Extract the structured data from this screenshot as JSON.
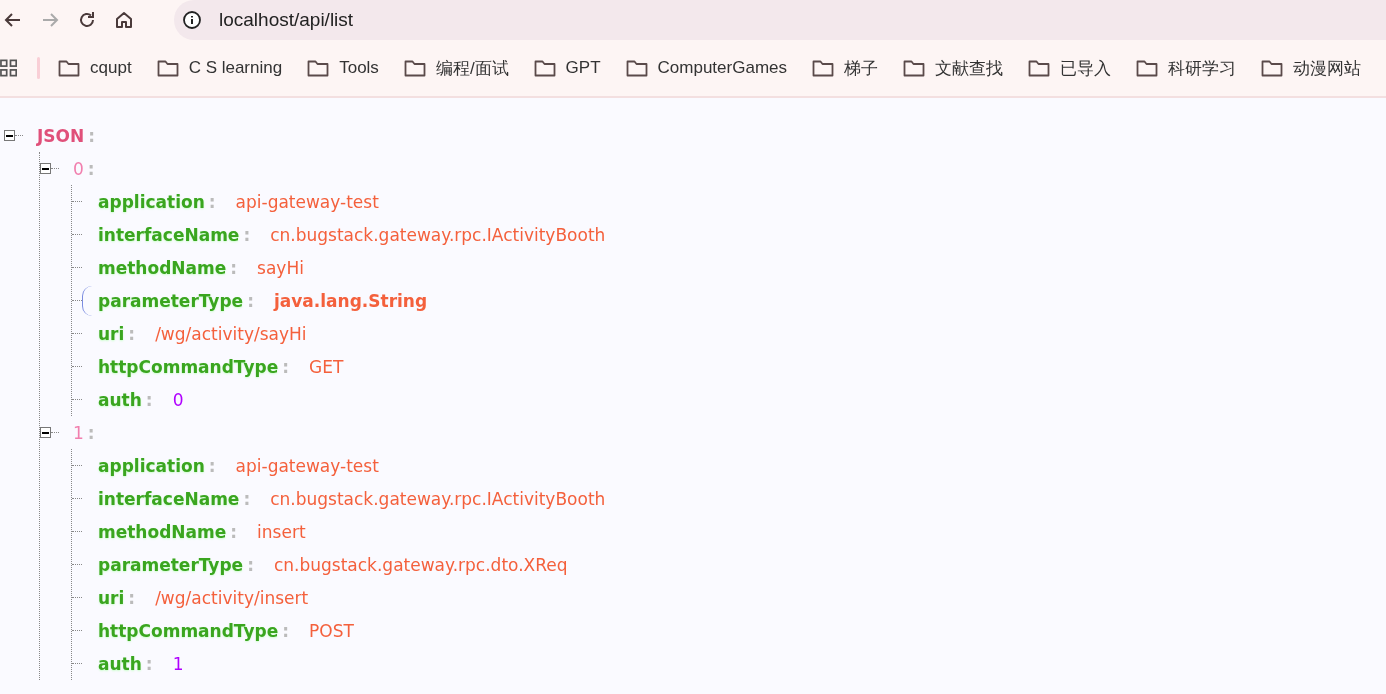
{
  "toolbar": {
    "back": {
      "disabled": false
    },
    "forward": {
      "disabled": true
    },
    "url": "localhost/api/list"
  },
  "bookmarks": [
    {
      "label": "cqupt"
    },
    {
      "label": "C S learning"
    },
    {
      "label": "Tools"
    },
    {
      "label": "编程/面试"
    },
    {
      "label": "GPT"
    },
    {
      "label": "ComputerGames"
    },
    {
      "label": "梯子"
    },
    {
      "label": "文献查找"
    },
    {
      "label": "已导入"
    },
    {
      "label": "科研学习"
    },
    {
      "label": "动漫网站"
    }
  ],
  "tree": {
    "key": "JSON",
    "sep": ":",
    "expanded": true,
    "children": [
      {
        "key": "0",
        "sep": ":",
        "expanded": true,
        "fields": [
          {
            "key": "application",
            "sep": ":",
            "value": "api-gateway-test",
            "kind": "string",
            "hovered": false
          },
          {
            "key": "interfaceName",
            "sep": ":",
            "value": "cn.bugstack.gateway.rpc.IActivityBooth",
            "kind": "string",
            "hovered": false
          },
          {
            "key": "methodName",
            "sep": ":",
            "value": "sayHi",
            "kind": "string",
            "hovered": false
          },
          {
            "key": "parameterType",
            "sep": ":",
            "value": "java.lang.String",
            "kind": "string",
            "hovered": true
          },
          {
            "key": "uri",
            "sep": ":",
            "value": "/wg/activity/sayHi",
            "kind": "string",
            "hovered": false
          },
          {
            "key": "httpCommandType",
            "sep": ":",
            "value": "GET",
            "kind": "string",
            "hovered": false
          },
          {
            "key": "auth",
            "sep": ":",
            "value": "0",
            "kind": "number",
            "hovered": false
          }
        ]
      },
      {
        "key": "1",
        "sep": ":",
        "expanded": true,
        "fields": [
          {
            "key": "application",
            "sep": ":",
            "value": "api-gateway-test",
            "kind": "string",
            "hovered": false
          },
          {
            "key": "interfaceName",
            "sep": ":",
            "value": "cn.bugstack.gateway.rpc.IActivityBooth",
            "kind": "string",
            "hovered": false
          },
          {
            "key": "methodName",
            "sep": ":",
            "value": "insert",
            "kind": "string",
            "hovered": false
          },
          {
            "key": "parameterType",
            "sep": ":",
            "value": "cn.bugstack.gateway.rpc.dto.XReq",
            "kind": "string",
            "hovered": false
          },
          {
            "key": "uri",
            "sep": ":",
            "value": "/wg/activity/insert",
            "kind": "string",
            "hovered": false
          },
          {
            "key": "httpCommandType",
            "sep": ":",
            "value": "POST",
            "kind": "string",
            "hovered": false
          },
          {
            "key": "auth",
            "sep": ":",
            "value": "1",
            "kind": "number",
            "hovered": false
          }
        ]
      }
    ]
  }
}
